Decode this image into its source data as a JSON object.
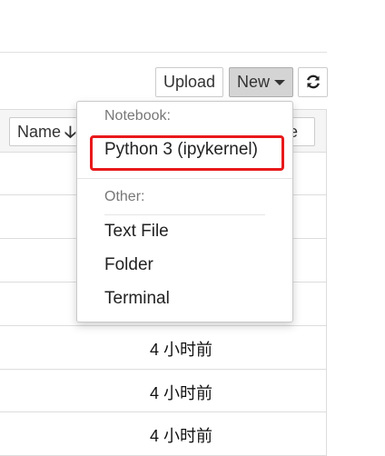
{
  "toolbar": {
    "upload_label": "Upload",
    "new_label": "New",
    "refresh_icon": "refresh-icon"
  },
  "list_header": {
    "name_label": "Name",
    "sort_icon": "arrow-down-icon",
    "modified_label": "te"
  },
  "rows": {
    "times": [
      "4 小时前",
      "4 小时前",
      "4 小时前"
    ]
  },
  "new_menu": {
    "notebook_header": "Notebook:",
    "kernel_item": "Python 3 (ipykernel)",
    "other_header": "Other:",
    "items": [
      "Text File",
      "Folder",
      "Terminal"
    ]
  },
  "colors": {
    "highlight": "#e8191b",
    "new_button_bg": "#d4d4d4"
  }
}
